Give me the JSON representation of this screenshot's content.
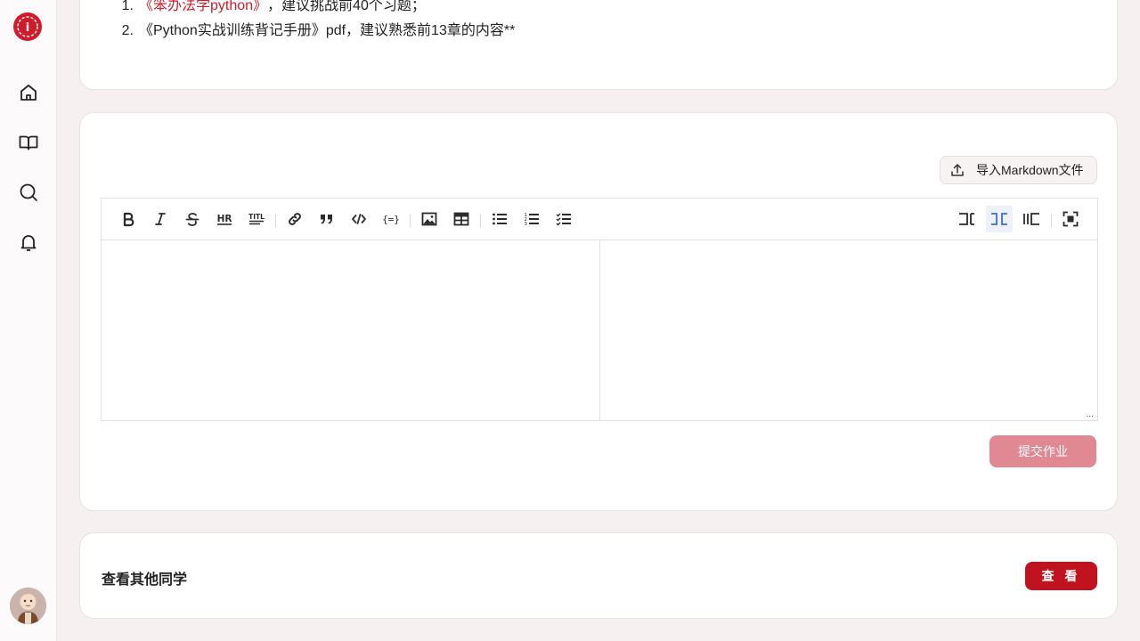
{
  "sidebar": {
    "logo": "school-logo",
    "items": [
      {
        "icon": "home-icon"
      },
      {
        "icon": "book-icon"
      },
      {
        "icon": "search-icon"
      },
      {
        "icon": "bell-icon"
      }
    ],
    "avatar": "user-avatar"
  },
  "resources": {
    "items": [
      {
        "num": "1.",
        "link": "《笨办法学python》",
        "text": "，建议挑战前40个习题；"
      },
      {
        "num": "2.",
        "text": "《Python实战训练背记手册》pdf，建议熟悉前13章的内容**"
      }
    ]
  },
  "editor": {
    "import_label": "导入Markdown文件",
    "toolbar": [
      "bold",
      "italic",
      "strikethrough",
      "heading",
      "title",
      "link",
      "quote",
      "code",
      "code-block",
      "image",
      "table",
      "unordered-list",
      "ordered-list",
      "checklist",
      "editor-only",
      "split-view",
      "preview-only",
      "fullscreen"
    ],
    "submit_label": "提交作业",
    "content": ""
  },
  "others": {
    "title": "查看其他同学",
    "button_label": "查 看"
  },
  "colors": {
    "accent": "#c1121f",
    "submit_disabled": "#e08993",
    "background": "#f6f0f0"
  }
}
